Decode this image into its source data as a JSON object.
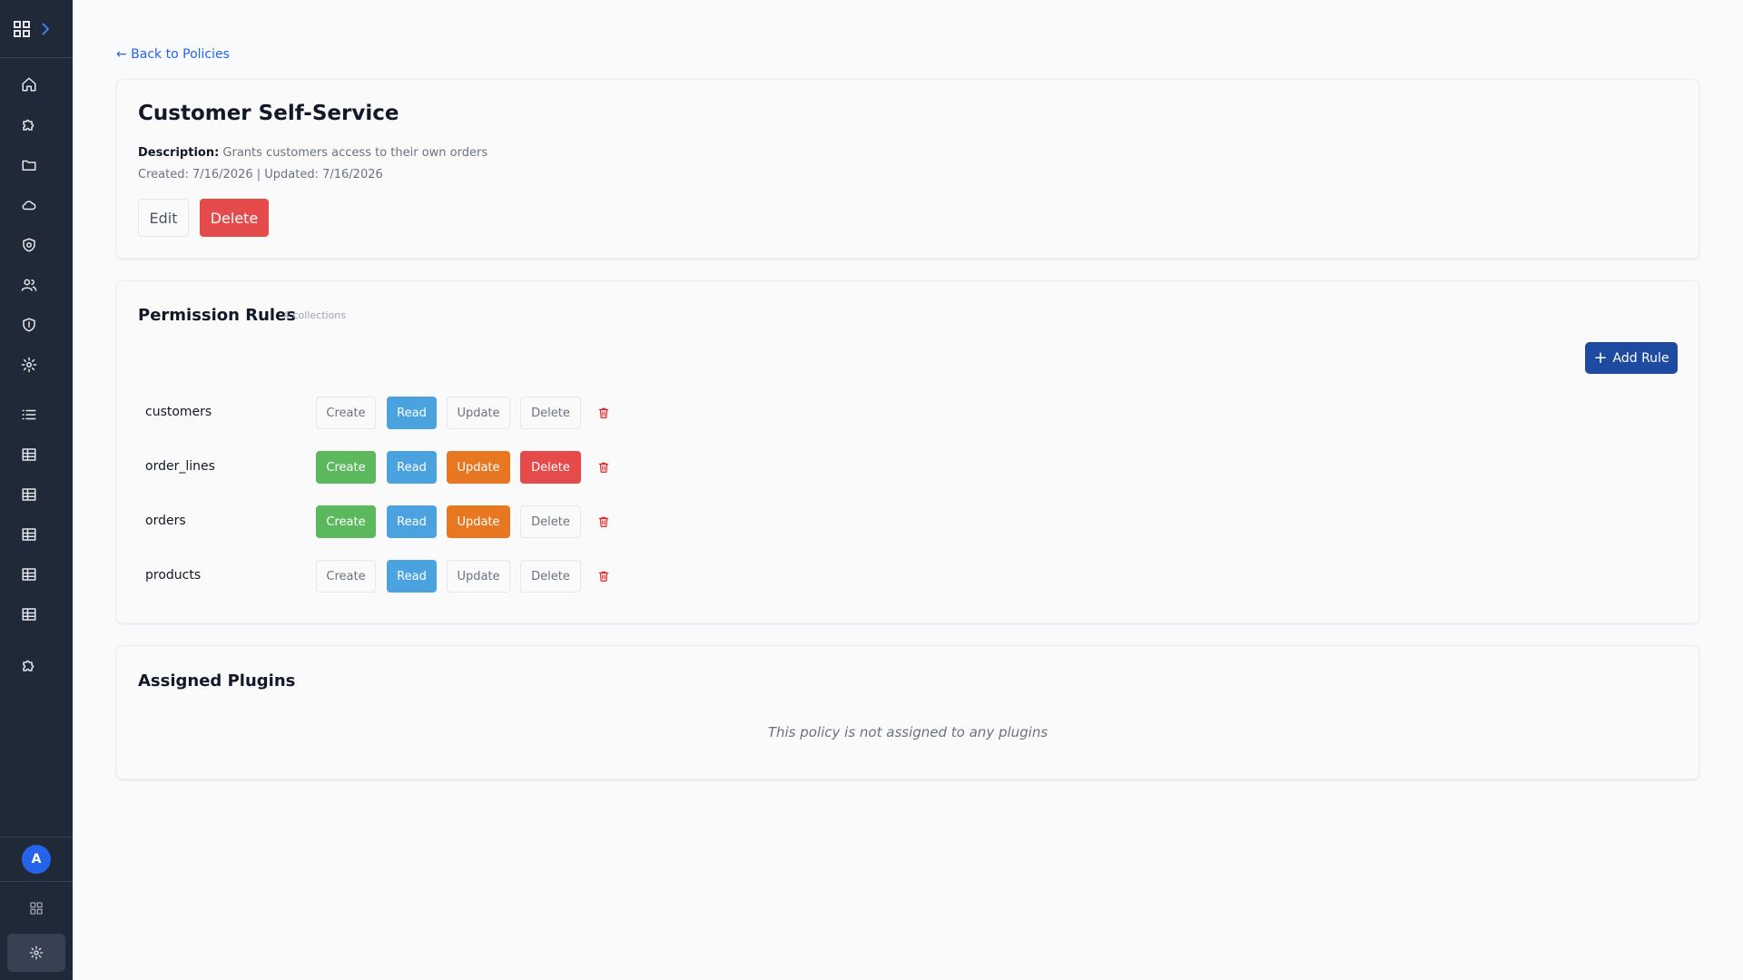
{
  "nav": {
    "back_link": "← Back to Policies",
    "avatar_initial": "A",
    "items": [
      {
        "icon": "home-icon"
      },
      {
        "icon": "puzzle-icon"
      },
      {
        "icon": "folder-icon"
      },
      {
        "icon": "cloud-icon"
      },
      {
        "icon": "shield-lock-icon"
      },
      {
        "icon": "users-icon"
      },
      {
        "icon": "shield-icon"
      },
      {
        "icon": "gear-icon"
      },
      {
        "icon": "list-icon"
      },
      {
        "icon": "table-icon"
      },
      {
        "icon": "table-icon"
      },
      {
        "icon": "table-icon"
      },
      {
        "icon": "table-icon"
      },
      {
        "icon": "table-icon"
      },
      {
        "icon": "puzzle-icon"
      }
    ]
  },
  "policy": {
    "title": "Customer Self-Service",
    "description_label": "Description:",
    "description": "Grants customers access to their own orders",
    "meta": "Created: 7/16/2026 | Updated: 7/16/2026",
    "edit_label": "Edit",
    "delete_label": "Delete"
  },
  "rules": {
    "title": "Permission Rules",
    "count": "4 collections",
    "add_label": "Add Rule",
    "action_labels": [
      "Create",
      "Read",
      "Update",
      "Delete"
    ],
    "rows": [
      {
        "name": "customers",
        "create": false,
        "read": true,
        "update": false,
        "delete": false
      },
      {
        "name": "order_lines",
        "create": true,
        "read": true,
        "update": true,
        "delete": true
      },
      {
        "name": "orders",
        "create": true,
        "read": true,
        "update": true,
        "delete": false
      },
      {
        "name": "products",
        "create": false,
        "read": true,
        "update": false,
        "delete": false
      }
    ]
  },
  "plugins": {
    "title": "Assigned Plugins",
    "empty": "This policy is not assigned to any plugins"
  },
  "colors": {
    "create": "#5cb85c",
    "read": "#4aa3df",
    "update": "#e87722",
    "delete": "#e54b4b",
    "accent": "#1e4ba0"
  }
}
